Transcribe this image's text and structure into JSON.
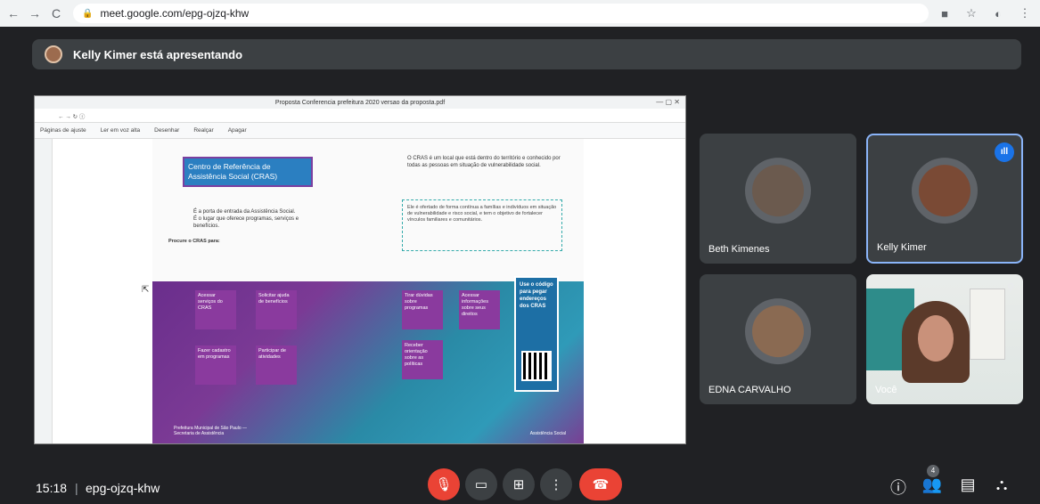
{
  "browser": {
    "url": "meet.google.com/epg-ojzq-khw",
    "back_icon": "arrow-left-icon",
    "forward_icon": "arrow-right-icon",
    "reload_icon": "reload-icon"
  },
  "presenting": {
    "text": "Kelly Kimer está apresentando"
  },
  "shared_screen": {
    "window_title": "Proposta Conferencia prefeitura 2020 versao da proposta.pdf",
    "toolbar": [
      "Páginas de ajuste",
      "Ler em voz alta",
      "Desenhar",
      "Realçar",
      "Apagar"
    ],
    "doc": {
      "cras_title": "Centro de Referência de Assistência Social (CRAS)",
      "cras_desc": "É a porta de entrada da Assistência Social. É o lugar que oferece programas, serviços e benefícios.",
      "intro": "O CRAS é um local que está dentro do território e conhecido por todas as pessoas em situação de vulnerabilidade social.",
      "box_text": "Ele é ofertado de forma contínua a famílias e indivíduos em situação de vulnerabilidade e risco social, e tem o objetivo de fortalecer vínculos familiares e comunitários.",
      "procure": "Procure o CRAS para:",
      "tiles": [
        "Acessar serviços do CRAS",
        "Solicitar ajuda de benefícios",
        "Tirar dúvidas sobre programas",
        "Acessar informações sobre seus direitos",
        "Fazer cadastro em programas",
        "Participar de atividades",
        "Receber orientação sobre as políticas"
      ],
      "qr_text": "Use o código para pegar endereços dos CRAS",
      "footer_left": "Prefeitura Municipal de São Paulo — Secretaria de Assistência",
      "footer_right": "Assistência Social"
    }
  },
  "participants": [
    {
      "name": "Beth Kimenes",
      "avatar_color": "#6b5a4e",
      "speaking": false
    },
    {
      "name": "Kelly Kimer",
      "avatar_color": "#7a4a35",
      "speaking": true
    },
    {
      "name": "EDNA CARVALHO",
      "avatar_color": "#8a6a52",
      "speaking": false
    },
    {
      "name": "Você",
      "camera_on": true
    }
  ],
  "bottom": {
    "time": "15:18",
    "separator": "|",
    "meeting_code": "epg-ojzq-khw",
    "controls": [
      {
        "name": "mic-off",
        "icon": "mic-off-icon",
        "glyph": "🎙"
      },
      {
        "name": "camera-off",
        "icon": "camera-off-icon",
        "glyph": "▭"
      },
      {
        "name": "present",
        "icon": "present-icon",
        "glyph": "⊞"
      },
      {
        "name": "more",
        "icon": "more-options-icon",
        "glyph": "⋮"
      },
      {
        "name": "leave",
        "icon": "hang-up-icon",
        "glyph": "☎"
      }
    ],
    "right_controls": [
      {
        "name": "info",
        "glyph": "ⓘ"
      },
      {
        "name": "people",
        "glyph": "👥",
        "badge": "4"
      },
      {
        "name": "chat",
        "glyph": "▤"
      },
      {
        "name": "activities",
        "glyph": "⛬"
      }
    ]
  },
  "colors": {
    "background": "#202124",
    "red": "#ea4335",
    "active_blue": "#8ab4f8"
  }
}
